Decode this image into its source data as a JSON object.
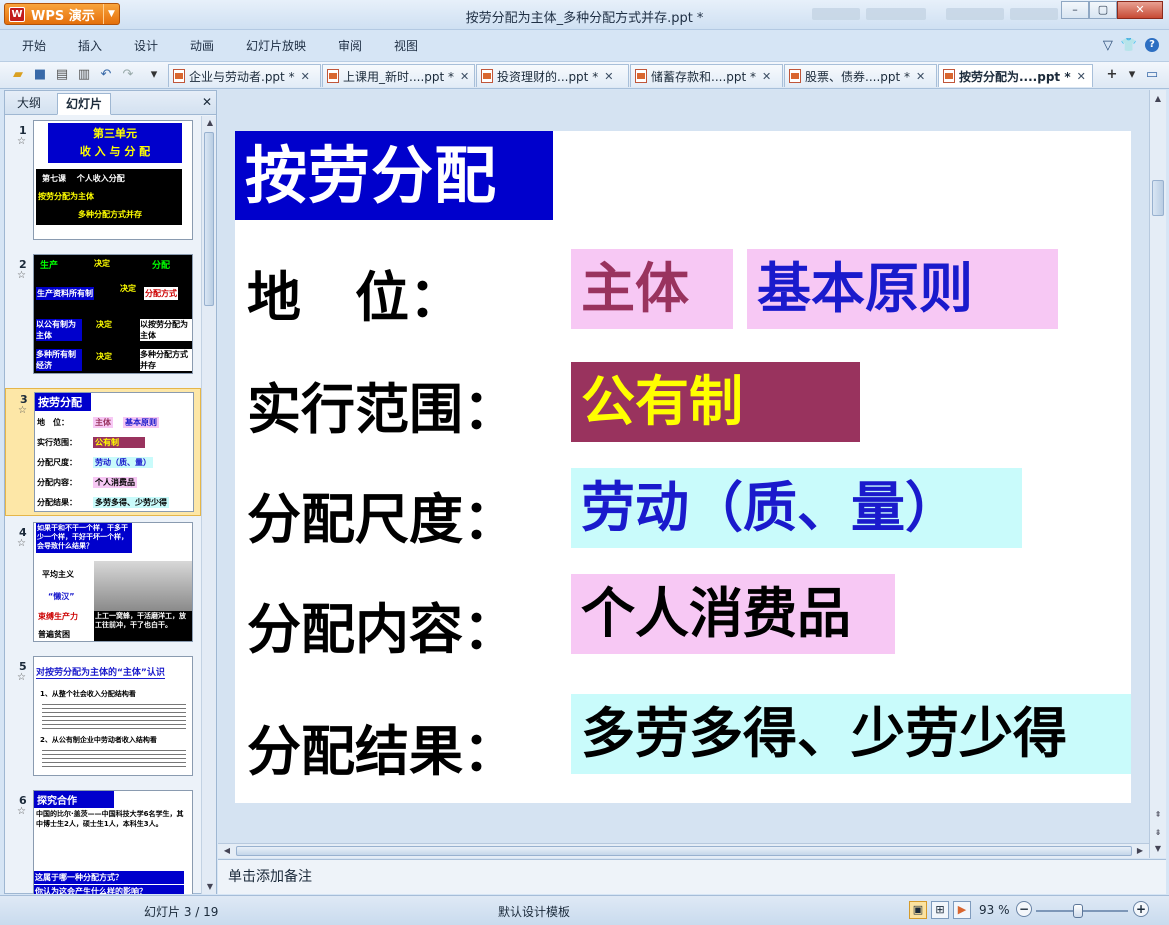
{
  "titlebar": {
    "app_button": "WPS 演示",
    "app_logo": "W",
    "window_title": "按劳分配为主体_多种分配方式并存.ppt *",
    "controls": {
      "minimize": "–",
      "maximize": "▢",
      "close": "✕"
    }
  },
  "menu": {
    "items": [
      "开始",
      "插入",
      "设计",
      "动画",
      "幻灯片放映",
      "审阅",
      "视图"
    ],
    "right_icons": [
      "chevron-down-icon",
      "shirt-icon",
      "help-icon"
    ],
    "help_label": "?"
  },
  "toolbar": {
    "icons": [
      "open-folder-icon",
      "save-icon",
      "print-icon",
      "print-preview-icon",
      "undo-icon",
      "redo-icon",
      "customize-icon"
    ]
  },
  "doc_tabs": [
    {
      "label": "企业与劳动者.ppt *",
      "active": false
    },
    {
      "label": "上课用_新时....ppt *",
      "active": false
    },
    {
      "label": "投资理财的...ppt *",
      "active": false
    },
    {
      "label": "储蓄存款和....ppt *",
      "active": false
    },
    {
      "label": "股票、债券....ppt *",
      "active": false
    },
    {
      "label": "按劳分配为....ppt *",
      "active": true
    }
  ],
  "left_pane": {
    "tabs": [
      "大纲",
      "幻灯片"
    ],
    "active_tab": "幻灯片",
    "close": "✕",
    "thumbnails": [
      {
        "num": "1",
        "lines": [
          "第三单元",
          "收 入 与 分 配",
          "第七课　 个人收入分配",
          "按劳分配为主体",
          "多种分配方式并存"
        ]
      },
      {
        "num": "2",
        "lines": [
          "生产",
          "决定",
          "分配",
          "生产资料所有制",
          "决定",
          "分配方式",
          "以公有制为主体",
          "决定",
          "以按劳分配为主体",
          "多种所有制经济",
          "决定",
          "多种分配方式并存"
        ]
      },
      {
        "num": "3",
        "lines": [
          "按劳分配",
          "地　位：",
          "主体",
          "基本原则",
          "实行范围：",
          "公有制",
          "分配尺度：",
          "劳动（质、量）",
          "分配内容：",
          "个人消费品",
          "分配结果：",
          "多劳多得、少劳少得"
        ]
      },
      {
        "num": "4",
        "lines": [
          "如果干和不干一个样，干多干少一个样，干好干坏一个样，会导致什么结果？",
          "平均主义",
          "“懒汉”",
          "束缚生产力",
          "普遍贫困",
          "上工一窝蜂，干活磨洋工，放工往前冲，干了也白干。"
        ]
      },
      {
        "num": "5",
        "lines": [
          "对按劳分配为主体的“主体”认识",
          "1、从整个社会收入分配结构看",
          "2、从公有制企业中劳动者收入结构看"
        ]
      },
      {
        "num": "6",
        "lines": [
          "探究合作",
          "中国的比尔·盖茨——中国科技大学6名学生，其中博士生2人，硕士生1人，本科生3人。",
          "这属于哪一种分配方式？",
          "你认为这会产生什么样的影响？"
        ]
      }
    ]
  },
  "slide": {
    "title": "按劳分配",
    "rows": [
      {
        "label": "地　位：",
        "values": [
          "主体",
          "基本原则"
        ]
      },
      {
        "label": "实行范围：",
        "values": [
          "公有制"
        ]
      },
      {
        "label": "分配尺度：",
        "values": [
          "劳动（质、量）"
        ]
      },
      {
        "label": "分配内容：",
        "values": [
          "个人消费品"
        ]
      },
      {
        "label": "分配结果：",
        "values": [
          "多劳多得、少劳少得"
        ]
      }
    ],
    "colors": {
      "title_bg": "#0000cc",
      "pink_bg": "#f7c8f4",
      "cyan_bg": "#c9fbfb",
      "plum_bg": "#99335e",
      "text_plum": "#99335e",
      "text_blue": "#1a1acc",
      "text_yellow": "#ffff00",
      "text_black": "#000000"
    }
  },
  "notes_placeholder": "单击添加备注",
  "status": {
    "slide_counter": "幻灯片 3 / 19",
    "template": "默认设计模板",
    "zoom": "93 %",
    "zoom_minus": "−",
    "zoom_plus": "+"
  }
}
